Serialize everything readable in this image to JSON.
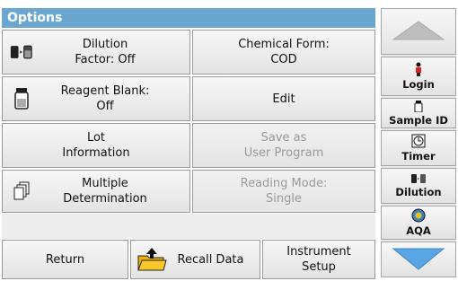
{
  "title": "Options",
  "buttons": {
    "dilution": "Dilution\nFactor: Off",
    "chemical_form": "Chemical Form:\nCOD",
    "reagent_blank": "Reagent Blank:\nOff",
    "edit": "Edit",
    "lot_information": "Lot\nInformation",
    "save_as": "Save as\nUser Program",
    "multiple_determination": "Multiple\nDetermination",
    "reading_mode": "Reading Mode:\nSingle",
    "return": "Return",
    "recall_data": "Recall\nData",
    "instrument_setup": "Instrument\nSetup"
  },
  "side": {
    "login": "Login",
    "sample_id": "Sample ID",
    "timer": "Timer",
    "dilution": "Dilution",
    "aqa": "AQA"
  },
  "colors": {
    "title_bar": "#6ba6d1",
    "arrow": "#5aa6e4"
  }
}
